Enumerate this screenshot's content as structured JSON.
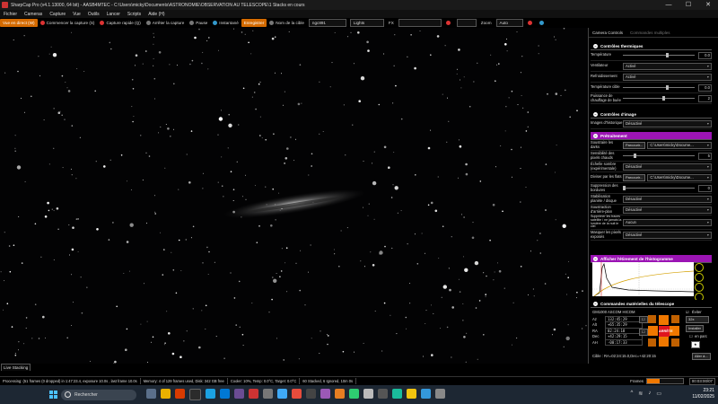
{
  "window": {
    "title": "SharpCap Pro (v4.1.13000, 64 bit) - AASB4MTEC - C:\\Users\\micky\\Documents\\ASTRONOMIE\\OBSERVATION AU TELESCOPE\\1 Stacks en cours",
    "controls": [
      "—",
      "☐",
      "✕"
    ]
  },
  "menu": [
    "Fichier",
    "Cameras",
    "Capture",
    "Vue",
    "Outils",
    "Lancer",
    "Scripts",
    "Aide (H)"
  ],
  "toolbar": {
    "live": "Vue en direct (W)",
    "start_capture": "Commencer la capture (S)",
    "quick_capture": "Capture rapide (Q)",
    "stop_capture": "Arrêter la capture",
    "pause": "Pause",
    "snapshot": "Instantané",
    "recording": "Enregistrer",
    "target_label": "Nom de la cible",
    "target_value": "ngc891",
    "frame_type": "Lights",
    "fx_label": "FX",
    "zoom_label": "Zoom",
    "zoom_value": "Auto"
  },
  "panel": {
    "tabs": [
      "Camera Controls",
      "Commandes multiples"
    ],
    "thermal": {
      "title": "Contrôles thermiques",
      "temperature_label": "Température",
      "temperature_value": "0.0",
      "fan_label": "Ventilateur",
      "fan_value": "Activé",
      "cooling_label": "Refroidissement",
      "cooling_value": "Activé",
      "target_temp_label": "Température cible",
      "target_temp_value": "0.0",
      "dew_label": "Puissance de chauffage de buée",
      "dew_value": "2"
    },
    "image": {
      "title": "Contrôles d'image",
      "history_label": "Images d'historique",
      "history_value": "Désactivé"
    },
    "preprocess": {
      "title": "Prétraitement",
      "darks_label": "Soustraire les darks",
      "browse": "Parcourir...",
      "darks_path": "C:\\Users\\micky\\Docume...",
      "hotpix_label": "Sensibilité des pixels chauds",
      "hotpix_value": "5",
      "dark_scale_label": "Échelle sombre (expérimentale)",
      "dark_scale_value": "Désactivé",
      "flats_label": "Diviser par les flats",
      "flats_path": "C:\\Users\\micky\\Docume...",
      "borders_label": "Suppression des bordures",
      "borders_value": "0",
      "planet_label": "Stabilisation planète / disque",
      "planet_value": "Désactivé",
      "background_label": "Soustraction d'arrière-plan",
      "background_value": "Désactivé",
      "satellite_label": "Supprimer les traces satellite / ne jamais la lumière de la nuit le ciel",
      "satellite_value": "Aucun",
      "exposed_label": "Masquer les pixels exposés",
      "exposed_value": "Désactivé"
    },
    "histogram": {
      "title": "Afficher l'étirement de l'histogramme"
    },
    "mount": {
      "title": "Commandes matérielles du télescope",
      "device": "GM1000 ASCOM HICOM",
      "az_label": "Az",
      "az_value": "132:45:29",
      "alt_label": "Alt",
      "alt_value": "+65:35:29",
      "ra_label": "RA",
      "ra_value": "02:24:18",
      "dec_label": "Dec",
      "dec_value": "+42:29:15",
      "ah_label": "AH",
      "ah_value": "-00:17:33",
      "go_label": "ARRÊTE",
      "avoid_label": "Éviter",
      "speed_value": "32x",
      "install_label": "Installer",
      "park_label": "en parc",
      "target_line": "Cible : RA=02:24:15.0,Dec=+42:20:15",
      "goto_label": "Aller à..."
    }
  },
  "log": {
    "tab": "Live Stacking"
  },
  "status": {
    "processing": "Processing: (51 frames (0 dropped) in 1:47:23.4, exposure 10.0s , last frame 10.0s",
    "memory": "Memory: 4 of 129 frames used, Disk: 342 GB free",
    "cooler": "Cooler: 10%, Temp: 0.0°C, Target: 0.0°C",
    "stack": "60 Stacked, 6 Ignored, 10m 0s",
    "frames_label": "Frames",
    "frames_progress": 0.35,
    "elapsed": "00:03:00/07"
  },
  "taskbar": {
    "search_placeholder": "Rechercher",
    "time": "23:21",
    "date": "11/02/2025"
  },
  "colors": {
    "accent_orange": "#f07800",
    "section_magenta": "#9b14b4",
    "stop_red": "#e0141e"
  }
}
